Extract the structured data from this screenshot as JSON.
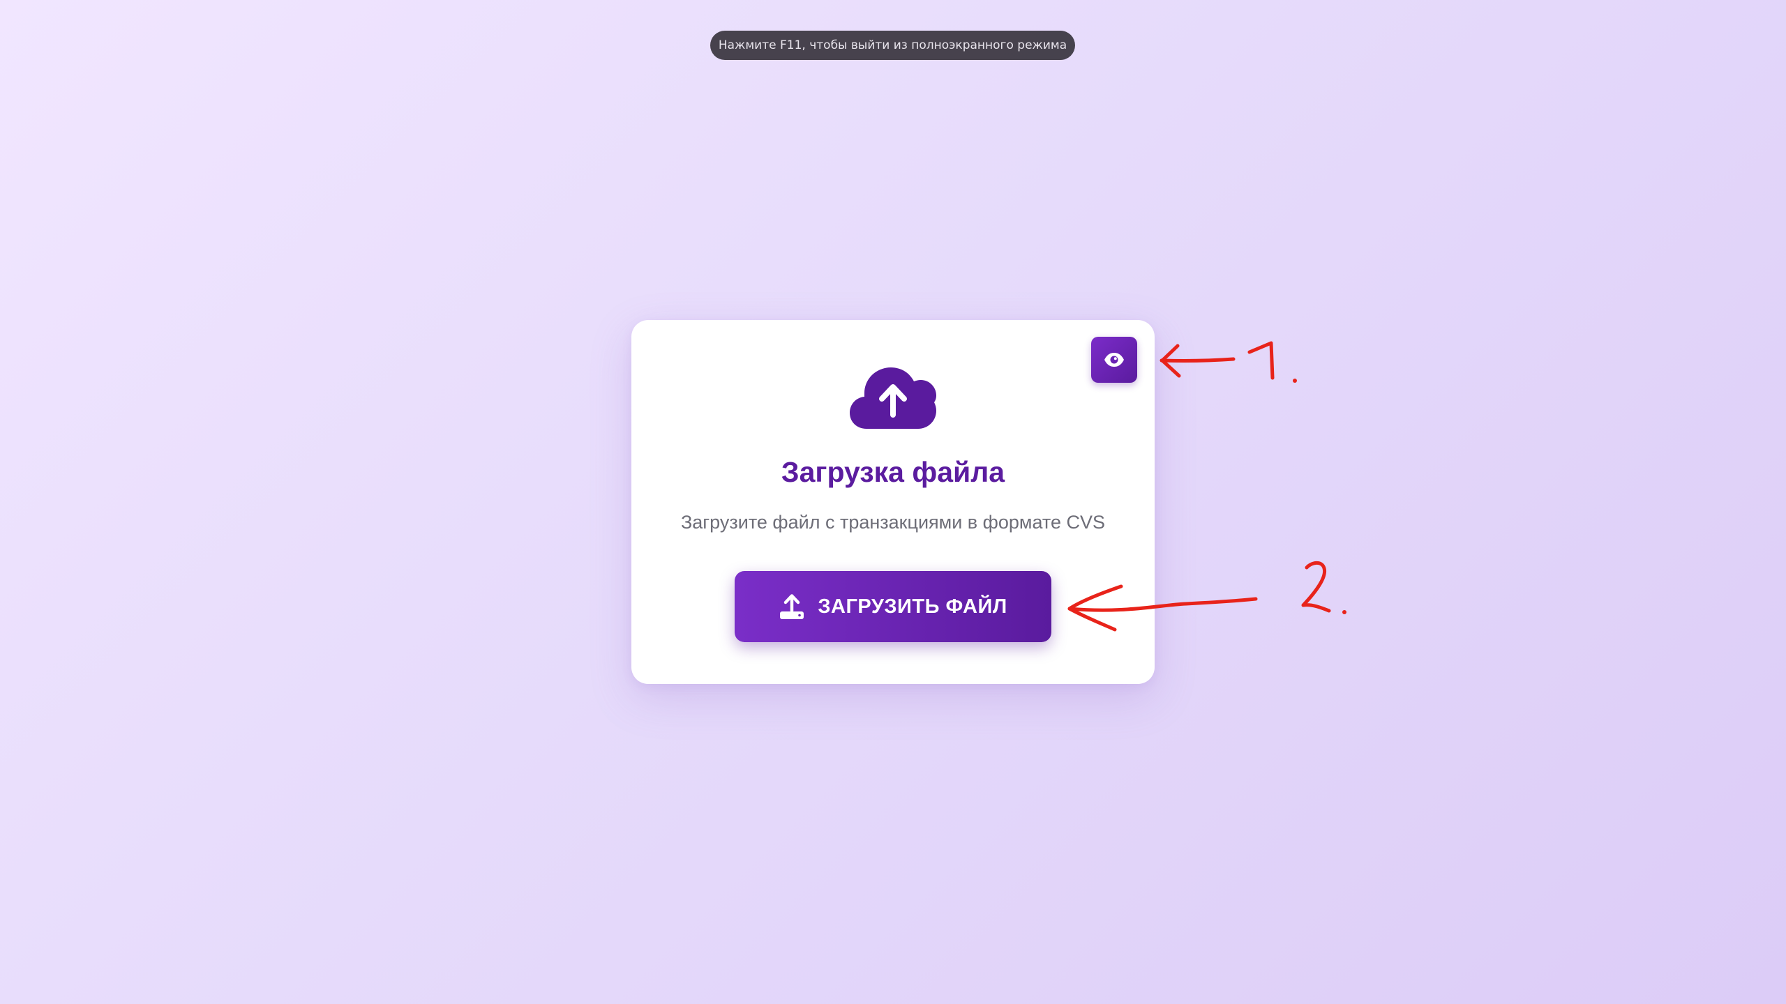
{
  "fullscreen_hint": {
    "text": "Нажмите F11, чтобы выйти из полноэкранного режима"
  },
  "card": {
    "title": "Загрузка файла",
    "subtitle": "Загрузите файл с транзакциями в формате CVS",
    "upload_button_label": "ЗАГРУЗИТЬ ФАЙЛ",
    "toggle_icon": "eye-icon",
    "hero_icon": "cloud-upload-icon",
    "button_icon": "upload-icon"
  },
  "annotations": {
    "marker_1": "1.",
    "marker_2": "2.",
    "color": "#e8231a"
  },
  "colors": {
    "accent": "#5b1c9f",
    "accent_light": "#7a2ec8",
    "subtitle": "#6d6d77",
    "card_bg": "#ffffff"
  }
}
